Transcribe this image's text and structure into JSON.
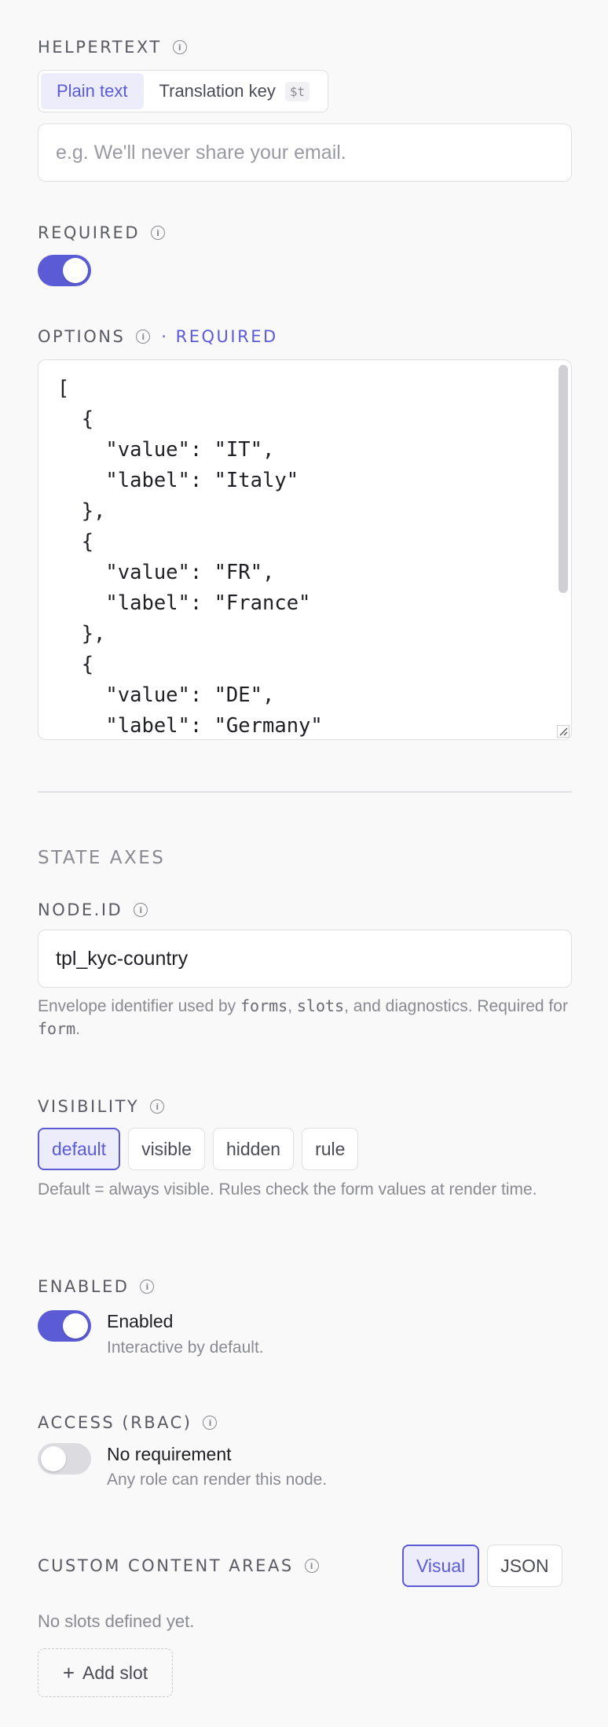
{
  "helpertext": {
    "label": "HELPERTEXT",
    "modes": [
      "Plain text",
      "Translation key"
    ],
    "key_chip": "$t",
    "placeholder": "e.g. We'll never share your email."
  },
  "required": {
    "label": "REQUIRED",
    "on": true
  },
  "options": {
    "label": "OPTIONS",
    "required_tag": "· REQUIRED",
    "code": "[\n  {\n    \"value\": \"IT\",\n    \"label\": \"Italy\"\n  },\n  {\n    \"value\": \"FR\",\n    \"label\": \"France\"\n  },\n  {\n    \"value\": \"DE\",\n    \"label\": \"Germany\""
  },
  "state_axes": {
    "heading": "STATE AXES",
    "node_id": {
      "label": "NODE.ID",
      "value": "tpl_kyc-country",
      "help_pre": "Envelope identifier used by ",
      "help_code1": "forms",
      "help_sep1": ", ",
      "help_code2": "slots",
      "help_mid": ", and diagnostics. Required for ",
      "help_code3": "form",
      "help_end": "."
    },
    "visibility": {
      "label": "VISIBILITY",
      "options": [
        "default",
        "visible",
        "hidden",
        "rule"
      ],
      "selected": "default",
      "help": "Default = always visible. Rules check the form values at render time."
    },
    "enabled": {
      "label": "ENABLED",
      "on": true,
      "title": "Enabled",
      "subtitle": "Interactive by default."
    },
    "access": {
      "label": "ACCESS (RBAC)",
      "on": false,
      "title": "No requirement",
      "subtitle": "Any role can render this node."
    }
  },
  "custom_content": {
    "label": "CUSTOM CONTENT AREAS",
    "modes": [
      "Visual",
      "JSON"
    ],
    "empty_text": "No slots defined yet.",
    "add_label": "Add slot"
  },
  "colors": {
    "accent": "#5b5bd6",
    "accent_bg": "#ececfb",
    "muted": "#8a8a92"
  }
}
